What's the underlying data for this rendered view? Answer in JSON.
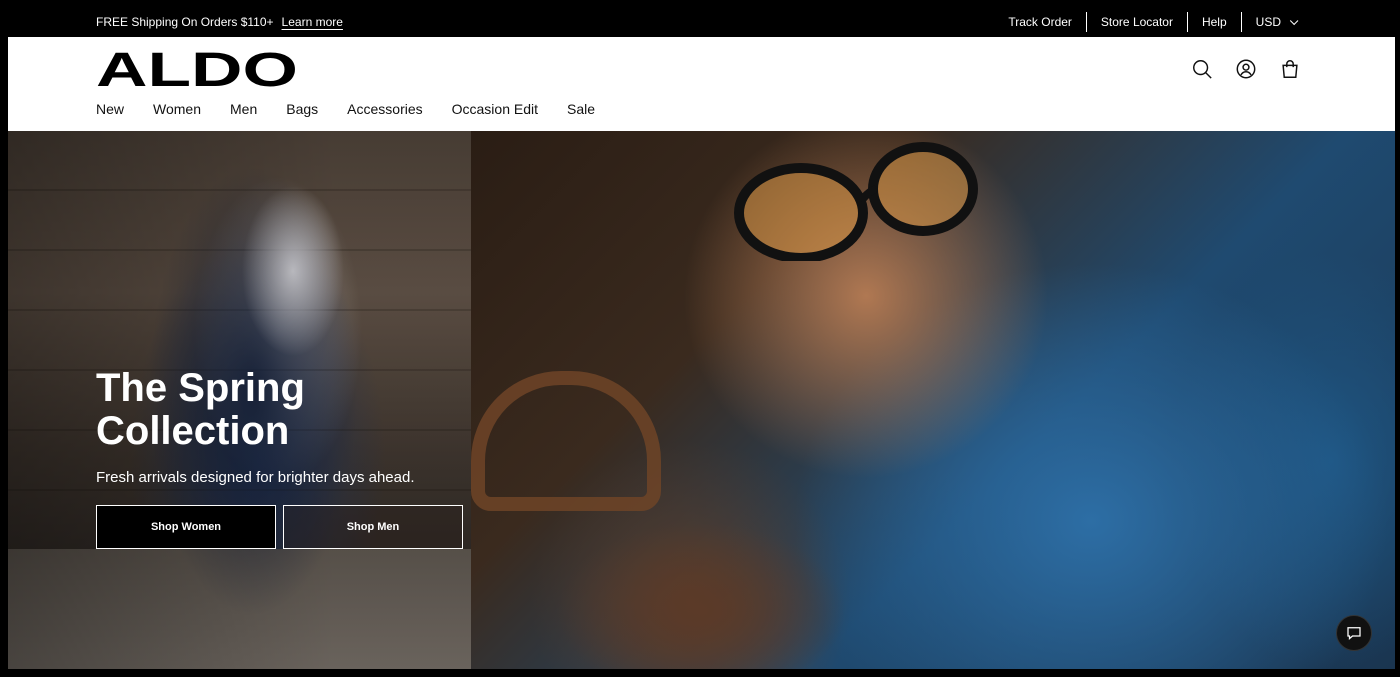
{
  "promo": {
    "message": "FREE Shipping On Orders $110+",
    "link": "Learn more"
  },
  "utility_nav": {
    "track_order": "Track Order",
    "store_locator": "Store Locator",
    "help": "Help",
    "currency": "USD"
  },
  "header": {
    "logo": "ALDO",
    "icons": [
      "search-icon",
      "account-icon",
      "bag-icon"
    ]
  },
  "nav": {
    "items": [
      "New",
      "Women",
      "Men",
      "Bags",
      "Accessories",
      "Occasion Edit",
      "Sale"
    ]
  },
  "hero": {
    "title": "The Spring Collection",
    "subtitle": "Fresh arrivals designed for brighter days ahead.",
    "shop_women": "Shop Women",
    "shop_men": "Shop Men"
  },
  "chat": {
    "icon": "chat-icon"
  },
  "colors": {
    "promo_bg": "#000000",
    "header_bg": "#ffffff",
    "text_dark": "#111111"
  }
}
